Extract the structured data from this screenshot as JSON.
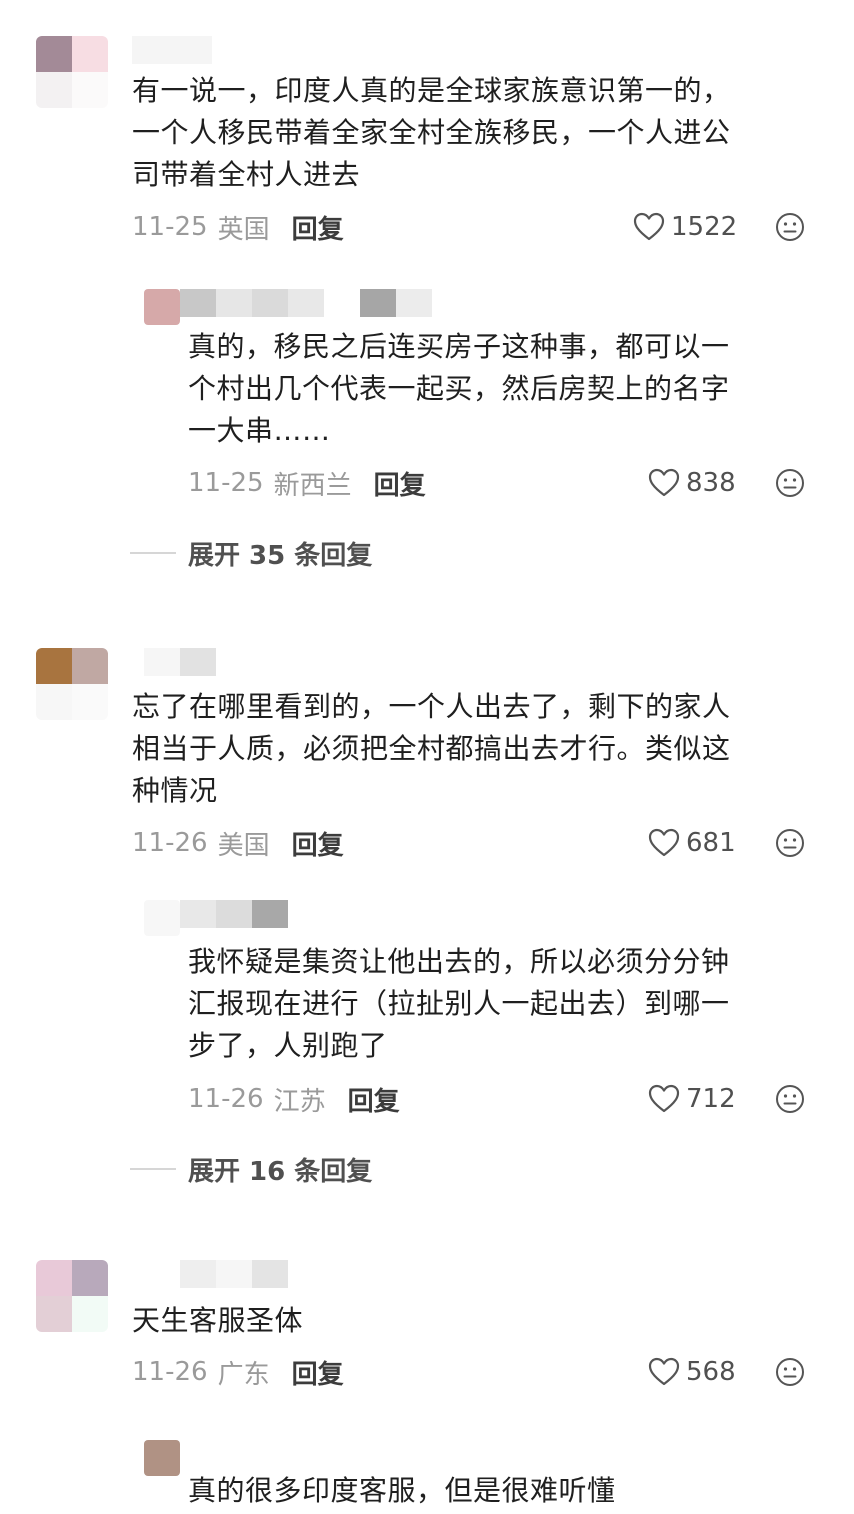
{
  "comments": [
    {
      "text": "有一说一，印度人真的是全球家族意识第一的，\n一个人移民带着全家全村全族移民，一个人进公\n司带着全村人进去",
      "date": "11-25",
      "location": "英国",
      "reply_label": "回复",
      "likes": "1522",
      "replies": [
        {
          "text": "真的，移民之后连买房子这种事，都可以一\n个村出几个代表一起买，然后房契上的名字\n一大串……",
          "date": "11-25",
          "location": "新西兰",
          "reply_label": "回复",
          "likes": "838"
        }
      ],
      "expand_label": "展开 35 条回复"
    },
    {
      "text": "忘了在哪里看到的，一个人出去了，剩下的家人\n相当于人质，必须把全村都搞出去才行。类似这\n种情况",
      "date": "11-26",
      "location": "美国",
      "reply_label": "回复",
      "likes": "681",
      "replies": [
        {
          "text": "我怀疑是集资让他出去的，所以必须分分钟\n汇报现在进行（拉扯别人一起出去）到哪一\n步了，人别跑了",
          "date": "11-26",
          "location": "江苏",
          "reply_label": "回复",
          "likes": "712"
        }
      ],
      "expand_label": "展开 16 条回复"
    },
    {
      "text": "天生客服圣体",
      "date": "11-26",
      "location": "广东",
      "reply_label": "回复",
      "likes": "568",
      "replies": [
        {
          "text": "真的很多印度客服，但是很难听懂"
        }
      ]
    }
  ],
  "icons": {
    "like": "heart-outline-icon",
    "emoji": "neutral-face-icon"
  },
  "colors": {
    "meta_gray": "#9a9a9a",
    "text": "#1f1f1f",
    "reply_bold": "#3c3c3c"
  }
}
